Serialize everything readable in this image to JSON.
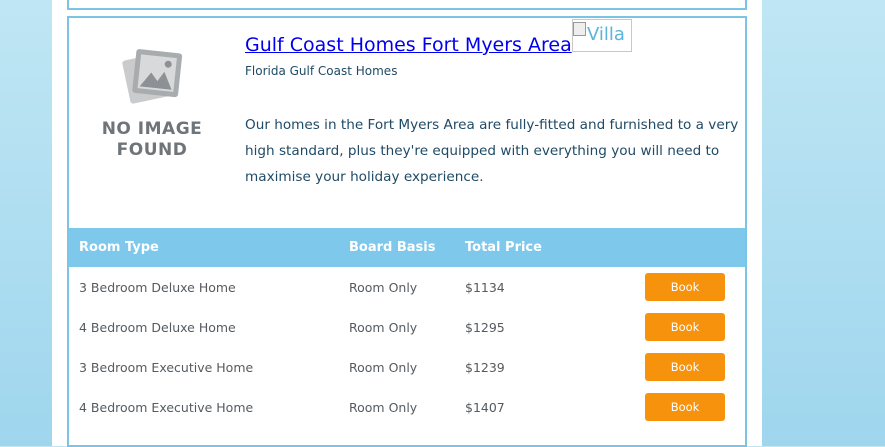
{
  "listing": {
    "title": "Gulf Coast Homes Fort Myers Area",
    "subtitle": "Florida Gulf Coast Homes",
    "description": "Our homes in the Fort Myers Area are fully-fitted and furnished to a very high standard, plus they're equipped with everything you will need to maximise your holiday experience.",
    "placeholder_image_text": "NO IMAGE FOUND",
    "broken_image_alt": "Villa"
  },
  "table": {
    "headers": {
      "room_type": "Room Type",
      "board_basis": "Board Basis",
      "total_price": "Total Price"
    },
    "rows": [
      {
        "room_type": "3 Bedroom Deluxe Home",
        "board_basis": "Room Only",
        "price": "$1134",
        "book_label": "Book"
      },
      {
        "room_type": "4 Bedroom Deluxe Home",
        "board_basis": "Room Only",
        "price": "$1295",
        "book_label": "Book"
      },
      {
        "room_type": "3 Bedroom Executive Home",
        "board_basis": "Room Only",
        "price": "$1239",
        "book_label": "Book"
      },
      {
        "room_type": "4 Bedroom Executive Home",
        "board_basis": "Room Only",
        "price": "$1407",
        "book_label": "Book"
      }
    ]
  },
  "colors": {
    "accent_blue": "#7ec8ec",
    "book_orange": "#f7920d",
    "link_blue": "#0000ee"
  }
}
